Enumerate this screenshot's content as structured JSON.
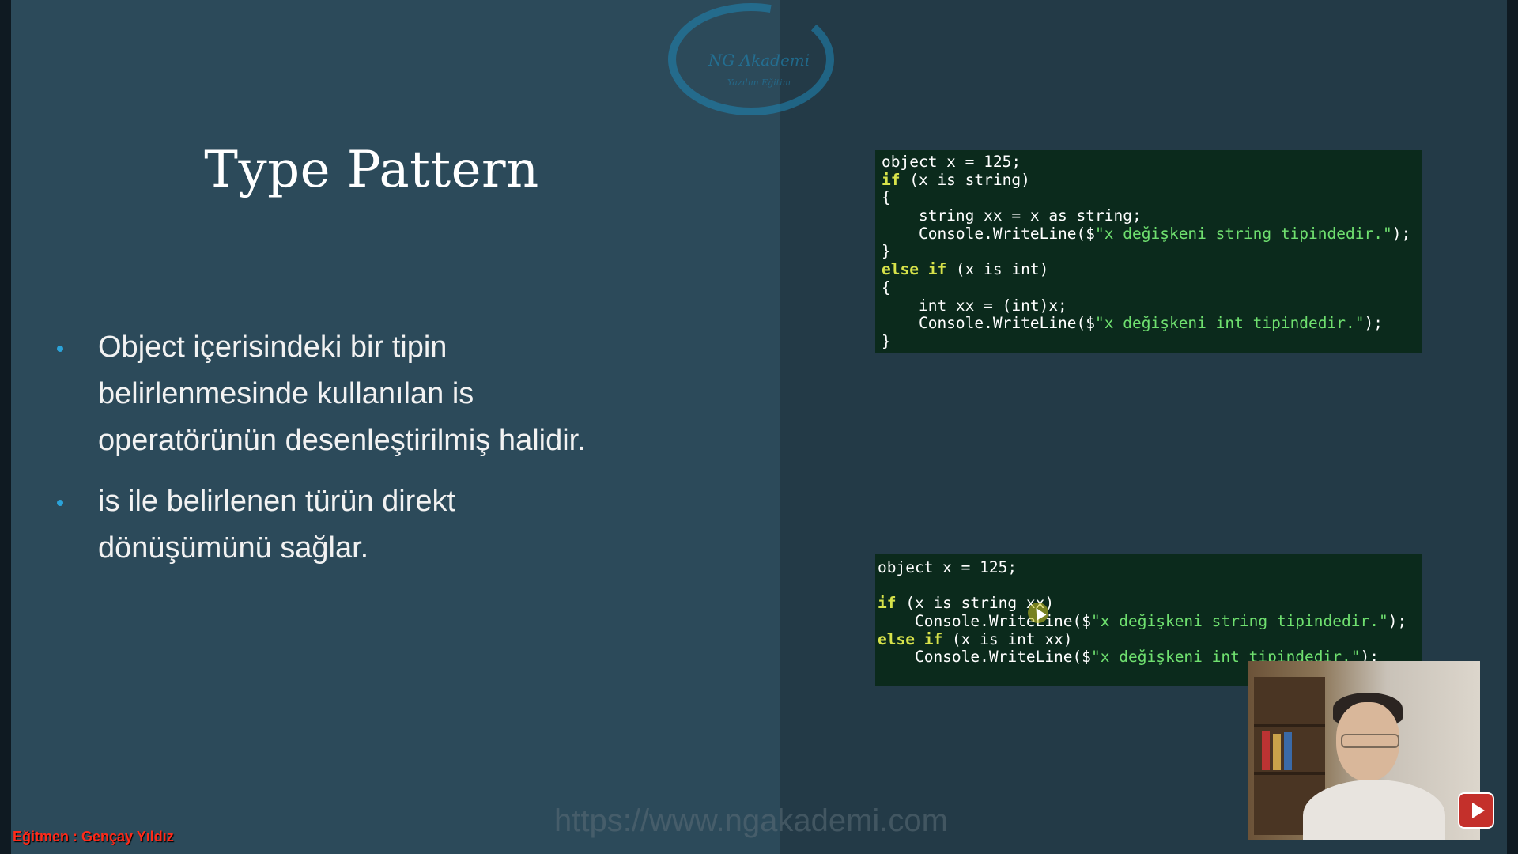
{
  "slide": {
    "logo_text": "NG Akademi",
    "logo_subtext": "Yazılım Eğitim",
    "title": "Type Pattern",
    "bullets": [
      [
        "Object içerisindeki bir tipin",
        "belirlenmesinde kullanılan is",
        "operatörünün desenleştirilmiş halidir."
      ],
      [
        "is ile belirlenen türün direkt",
        "dönüşümünü sağlar."
      ]
    ],
    "url_watermark": "https://www.ngakademi.com",
    "instructor_label": "Eğitmen : Gençay Yıldız"
  },
  "code_block_1": [
    [
      {
        "t": "object x = 125;",
        "c": "plain"
      }
    ],
    [
      {
        "t": "if",
        "c": "kw"
      },
      {
        "t": " (x is string)",
        "c": "plain"
      }
    ],
    [
      {
        "t": "{",
        "c": "plain"
      }
    ],
    [
      {
        "t": "    string xx = x as string;",
        "c": "plain"
      }
    ],
    [
      {
        "t": "    Console.WriteLine($",
        "c": "plain"
      },
      {
        "t": "\"x değişkeni string tipindedir.\"",
        "c": "str"
      },
      {
        "t": ");",
        "c": "plain"
      }
    ],
    [
      {
        "t": "}",
        "c": "plain"
      }
    ],
    [
      {
        "t": "else if",
        "c": "kw"
      },
      {
        "t": " (x is int)",
        "c": "plain"
      }
    ],
    [
      {
        "t": "{",
        "c": "plain"
      }
    ],
    [
      {
        "t": "    int xx = (int)x;",
        "c": "plain"
      }
    ],
    [
      {
        "t": "    Console.WriteLine($",
        "c": "plain"
      },
      {
        "t": "\"x değişkeni int tipindedir.\"",
        "c": "str"
      },
      {
        "t": ");",
        "c": "plain"
      }
    ],
    [
      {
        "t": "}",
        "c": "plain"
      }
    ]
  ],
  "code_block_2": [
    [
      {
        "t": "object x = 125;",
        "c": "plain"
      }
    ],
    [
      {
        "t": "",
        "c": "plain"
      }
    ],
    [
      {
        "t": "if",
        "c": "kw"
      },
      {
        "t": " (x is string xx)",
        "c": "plain"
      }
    ],
    [
      {
        "t": "    Console.WriteLine($",
        "c": "plain"
      },
      {
        "t": "\"x değişkeni string tipindedir.\"",
        "c": "str"
      },
      {
        "t": ");",
        "c": "plain"
      }
    ],
    [
      {
        "t": "else if",
        "c": "kw"
      },
      {
        "t": " (x is int xx)",
        "c": "plain"
      }
    ],
    [
      {
        "t": "    Console.WriteLine($",
        "c": "plain"
      },
      {
        "t": "\"x değişkeni int tipindedir.\"",
        "c": "str"
      },
      {
        "t": ");",
        "c": "plain"
      }
    ]
  ],
  "overlay": {
    "webcam_icon": "presenter-webcam",
    "youtube_icon": "youtube-play-icon",
    "youtube_color": "#c4302b"
  }
}
